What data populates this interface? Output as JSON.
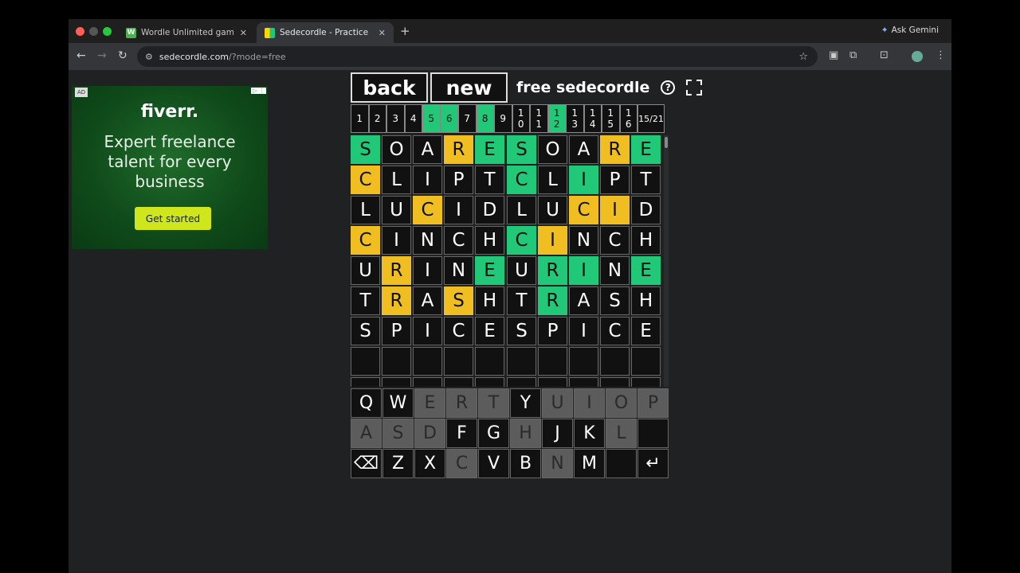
{
  "browser": {
    "tabs": [
      {
        "title": "Wordle Unlimited games - Wo",
        "favicon": "W",
        "active": false
      },
      {
        "title": "Sedecordle - Practice",
        "favicon": "sedecordle",
        "active": true
      }
    ],
    "new_tab": "+",
    "gemini_label": "Ask Gemini",
    "url_host": "sedecordle.com",
    "url_path": "/?mode=free"
  },
  "ad": {
    "badge": "AD",
    "choice": "▷ ⋮",
    "logo": "fiverr.",
    "headline_1": "Expert freelance",
    "headline_2": "talent for every",
    "headline_3": "business",
    "cta": "Get started"
  },
  "game": {
    "back_label": "back",
    "new_label": "new",
    "title": "free sedecordle",
    "help_symbol": "?",
    "boards": [
      {
        "label": "1",
        "solved": false
      },
      {
        "label": "2",
        "solved": false
      },
      {
        "label": "3",
        "solved": false
      },
      {
        "label": "4",
        "solved": false
      },
      {
        "label": "5",
        "solved": true
      },
      {
        "label": "6",
        "solved": true
      },
      {
        "label": "7",
        "solved": false
      },
      {
        "label": "8",
        "solved": true
      },
      {
        "label": "9",
        "solved": false
      },
      {
        "label": "10",
        "solved": false
      },
      {
        "label": "11",
        "solved": false
      },
      {
        "label": "12",
        "solved": true
      },
      {
        "label": "13",
        "solved": false
      },
      {
        "label": "14",
        "solved": false
      },
      {
        "label": "15",
        "solved": false
      },
      {
        "label": "16",
        "solved": false
      }
    ],
    "guess_count": "15/21",
    "guesses": [
      "SOARE",
      "CLIPT",
      "LUCID",
      "CINCH",
      "URINE",
      "TRASH",
      "SPICE"
    ],
    "left_board_colors": [
      "gbbyg",
      "ybbbb",
      "bbybb",
      "ybbbb",
      "bybbg",
      "bybyb",
      "bbbbb"
    ],
    "right_board_colors": [
      "gbbyg",
      "gbgbb",
      "bbyyb",
      "gybbb",
      "bggbg",
      "bgbbb",
      "bbbbb"
    ],
    "keyboard": {
      "row1": [
        "Q",
        "W",
        "E",
        "R",
        "T",
        "Y",
        "U",
        "I",
        "O",
        "P"
      ],
      "row2": [
        "A",
        "S",
        "D",
        "F",
        "G",
        "H",
        "J",
        "K",
        "L"
      ],
      "row3": [
        "Z",
        "X",
        "C",
        "V",
        "B",
        "N",
        "M"
      ],
      "used_keys": [
        "E",
        "R",
        "T",
        "U",
        "I",
        "O",
        "P",
        "A",
        "S",
        "D",
        "H",
        "L",
        "C",
        "N"
      ],
      "backspace_icon": "⌫",
      "enter_icon": "↵"
    }
  }
}
